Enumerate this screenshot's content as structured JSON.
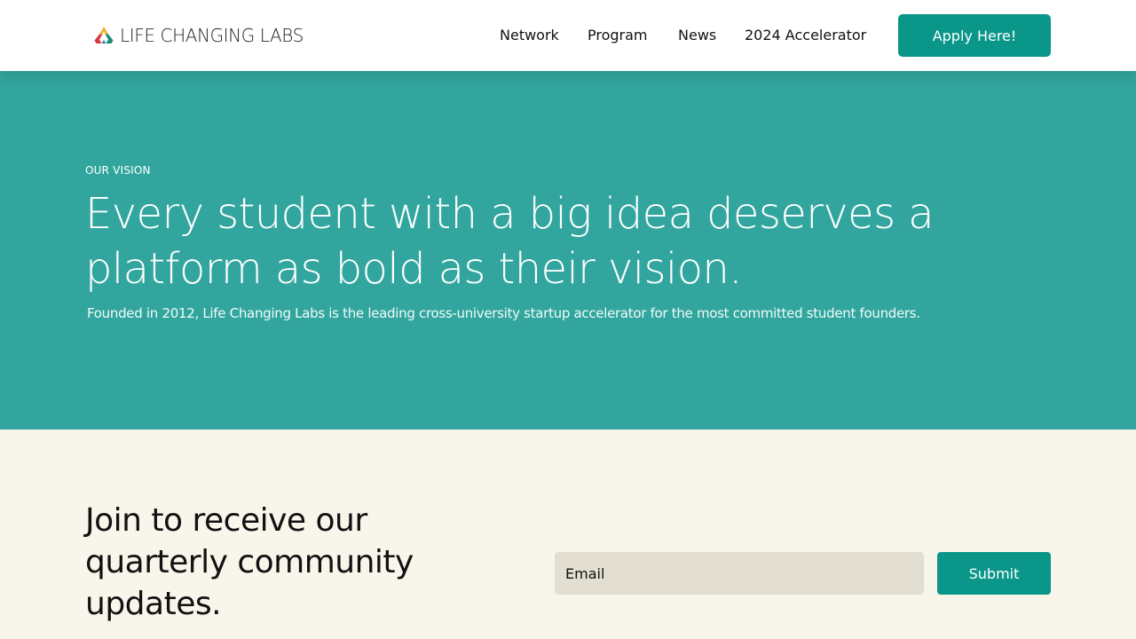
{
  "header": {
    "logo_text": "LIFE CHANGING LABS",
    "logo_icon": "recycle-triangle-icon",
    "nav": [
      "Network",
      "Program",
      "News",
      "2024 Accelerator"
    ],
    "cta_label": "Apply Here!"
  },
  "hero": {
    "eyebrow": "OUR VISION",
    "headline": "Every student with a big idea deserves a platform as bold as their vision.",
    "subtext": "Founded in 2012, Life Changing Labs is the leading cross-university startup accelerator for the most committed student founders."
  },
  "newsletter": {
    "heading": "Join to receive our quarterly community updates.",
    "email_placeholder": "Email",
    "submit_label": "Submit"
  },
  "colors": {
    "accent": "#0B968A",
    "hero_bg": "#32A69E",
    "page_bg": "#F8F5EA",
    "input_bg": "#E2DED1",
    "logo_red": "#D9383F",
    "logo_yellow": "#F2B233",
    "logo_green": "#1E8C6E",
    "logo_blue": "#2E7DA6"
  }
}
